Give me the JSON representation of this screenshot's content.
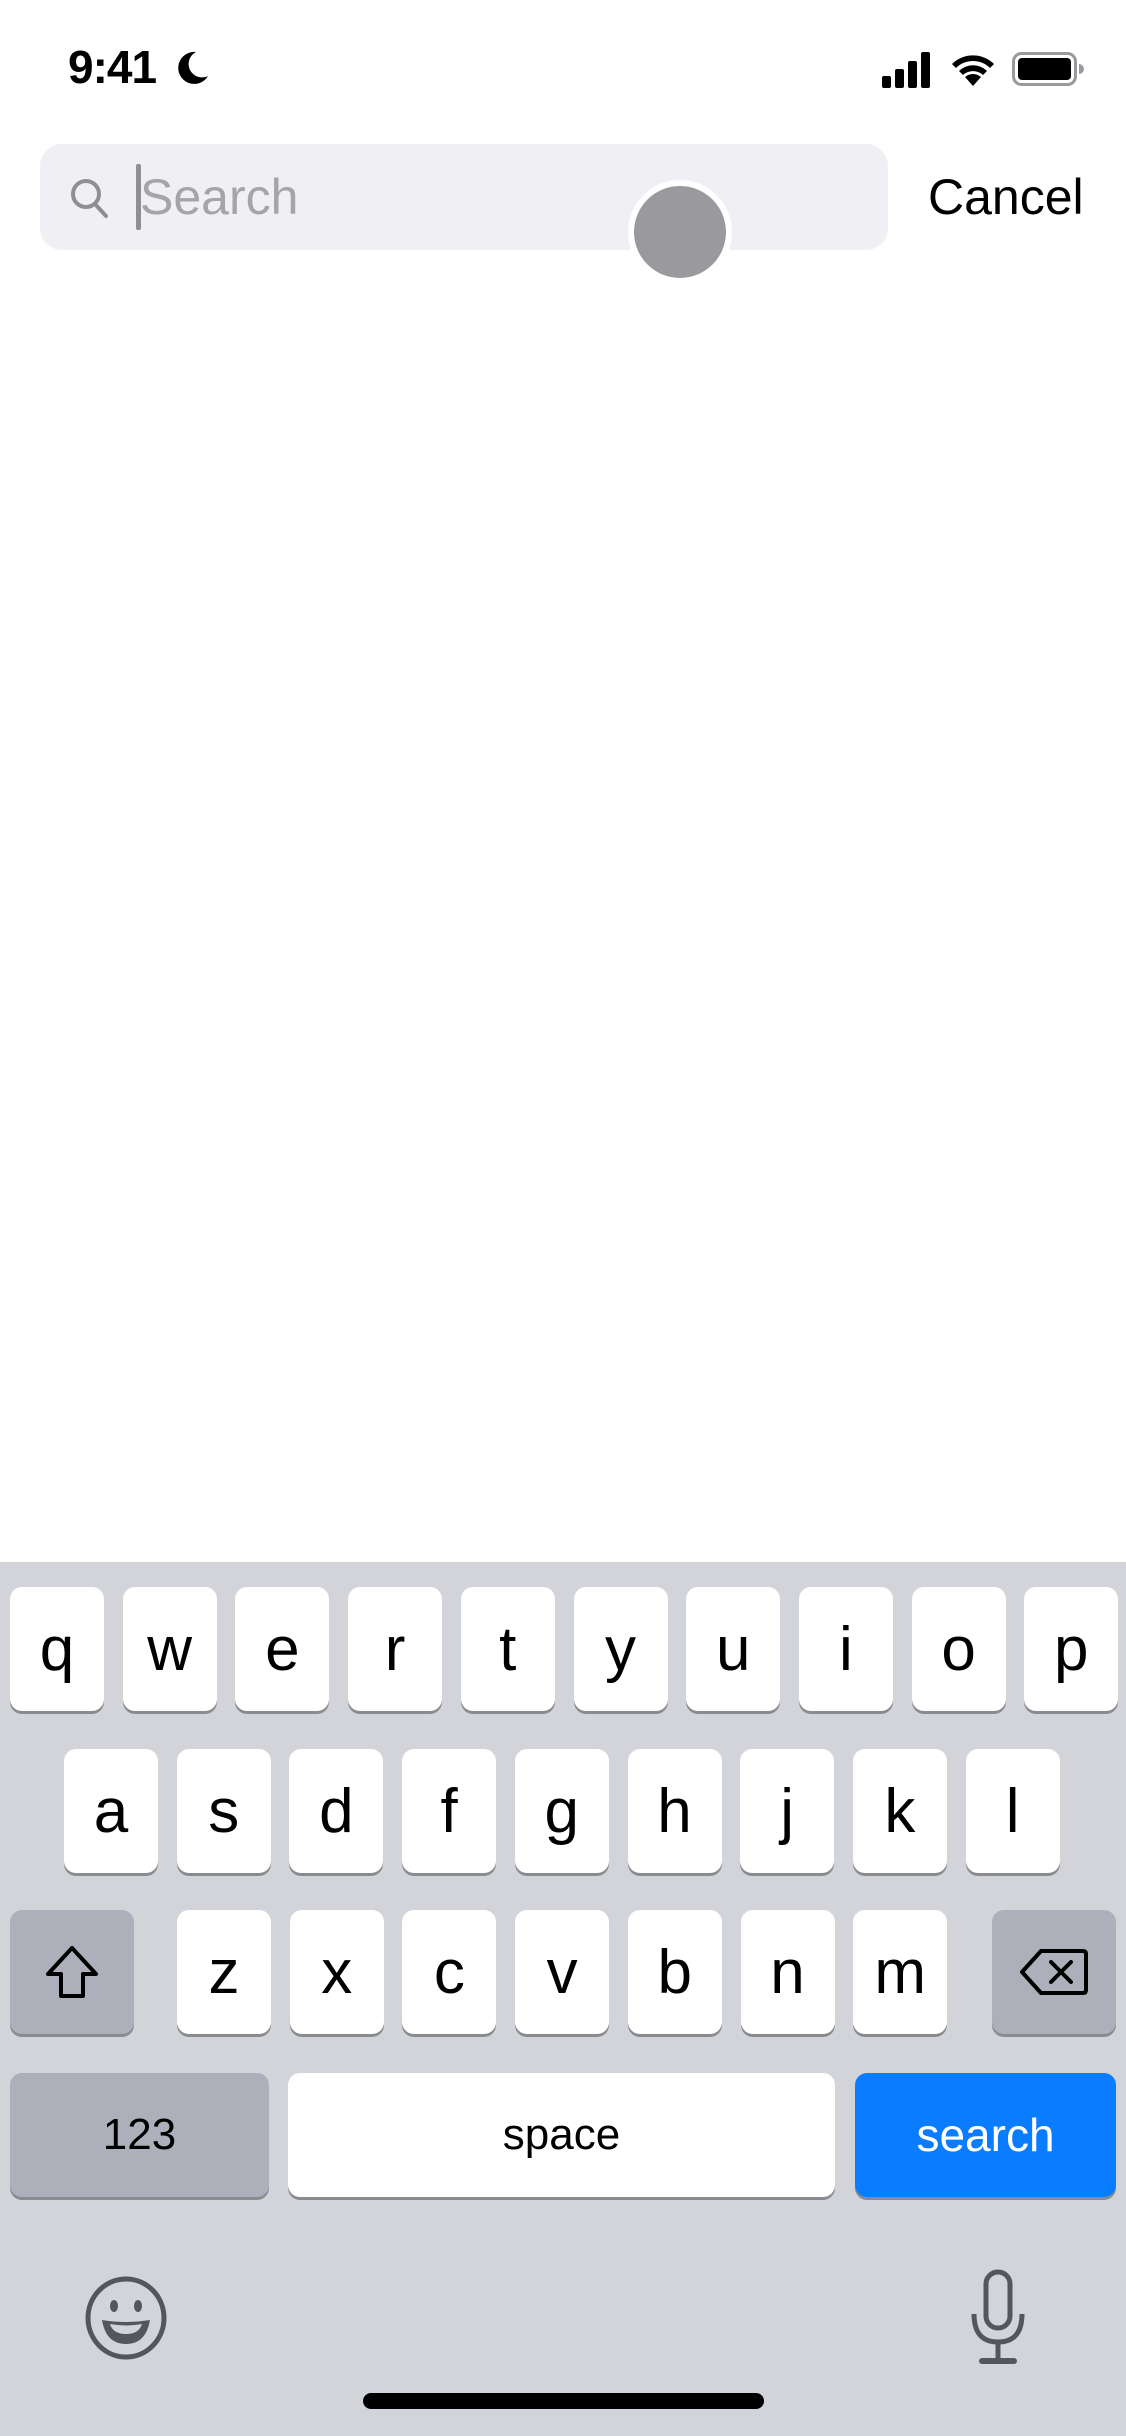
{
  "status_bar": {
    "time": "9:41",
    "focus_icon": "moon-icon",
    "signal_icon": "cellular-signal-icon",
    "wifi_icon": "wifi-icon",
    "battery_icon": "battery-icon"
  },
  "search": {
    "placeholder": "Search",
    "value": "",
    "icon": "search-icon",
    "cancel_label": "Cancel"
  },
  "keyboard": {
    "row1": [
      "q",
      "w",
      "e",
      "r",
      "t",
      "y",
      "u",
      "i",
      "o",
      "p"
    ],
    "row2": [
      "a",
      "s",
      "d",
      "f",
      "g",
      "h",
      "j",
      "k",
      "l"
    ],
    "row3": [
      "z",
      "x",
      "c",
      "v",
      "b",
      "n",
      "m"
    ],
    "shift_icon": "shift-icon",
    "delete_icon": "delete-icon",
    "numbers_label": "123",
    "space_label": "space",
    "return_label": "search",
    "return_color": "#0a7cff",
    "emoji_icon": "emoji-icon",
    "dictation_icon": "microphone-icon"
  }
}
